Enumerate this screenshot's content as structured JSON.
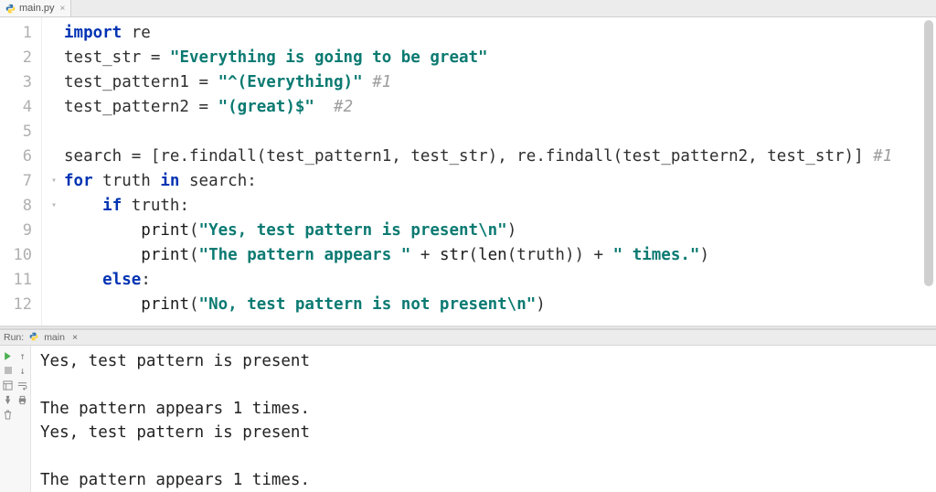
{
  "tabs": {
    "file": {
      "name": "main.py"
    }
  },
  "editor": {
    "line_numbers": [
      "1",
      "2",
      "3",
      "4",
      "5",
      "6",
      "7",
      "8",
      "9",
      "10",
      "11",
      "12"
    ],
    "lines": [
      {
        "tokens": [
          {
            "cls": "kw",
            "t": "import"
          },
          {
            "cls": "punct",
            "t": " "
          },
          {
            "cls": "ident",
            "t": "re"
          }
        ]
      },
      {
        "tokens": [
          {
            "cls": "ident",
            "t": "test_str "
          },
          {
            "cls": "punct",
            "t": "= "
          },
          {
            "cls": "str",
            "t": "\"Everything is going to be great\""
          }
        ]
      },
      {
        "tokens": [
          {
            "cls": "ident",
            "t": "test_pattern1 "
          },
          {
            "cls": "punct",
            "t": "= "
          },
          {
            "cls": "str",
            "t": "\"^(Everything)\""
          },
          {
            "cls": "punct",
            "t": " "
          },
          {
            "cls": "comment",
            "t": "#1"
          }
        ]
      },
      {
        "tokens": [
          {
            "cls": "ident",
            "t": "test_pattern2 "
          },
          {
            "cls": "punct",
            "t": "= "
          },
          {
            "cls": "str",
            "t": "\"(great)$\""
          },
          {
            "cls": "punct",
            "t": "  "
          },
          {
            "cls": "comment",
            "t": "#2"
          }
        ]
      },
      {
        "tokens": []
      },
      {
        "tokens": [
          {
            "cls": "ident",
            "t": "search "
          },
          {
            "cls": "punct",
            "t": "= ["
          },
          {
            "cls": "ident",
            "t": "re"
          },
          {
            "cls": "punct",
            "t": "."
          },
          {
            "cls": "ident",
            "t": "findall"
          },
          {
            "cls": "punct",
            "t": "("
          },
          {
            "cls": "ident",
            "t": "test_pattern1"
          },
          {
            "cls": "punct",
            "t": ", "
          },
          {
            "cls": "ident",
            "t": "test_str"
          },
          {
            "cls": "punct",
            "t": "), "
          },
          {
            "cls": "ident",
            "t": "re"
          },
          {
            "cls": "punct",
            "t": "."
          },
          {
            "cls": "ident",
            "t": "findall"
          },
          {
            "cls": "punct",
            "t": "("
          },
          {
            "cls": "ident",
            "t": "test_pattern2"
          },
          {
            "cls": "punct",
            "t": ", "
          },
          {
            "cls": "ident",
            "t": "test_str"
          },
          {
            "cls": "punct",
            "t": ")] "
          },
          {
            "cls": "comment",
            "t": "#1"
          }
        ]
      },
      {
        "fold": true,
        "tokens": [
          {
            "cls": "kw",
            "t": "for"
          },
          {
            "cls": "punct",
            "t": " "
          },
          {
            "cls": "ident",
            "t": "truth"
          },
          {
            "cls": "punct",
            "t": " "
          },
          {
            "cls": "kw",
            "t": "in"
          },
          {
            "cls": "punct",
            "t": " "
          },
          {
            "cls": "ident",
            "t": "search"
          },
          {
            "cls": "punct",
            "t": ":"
          }
        ]
      },
      {
        "indent": 1,
        "fold": true,
        "tokens": [
          {
            "cls": "kw",
            "t": "if"
          },
          {
            "cls": "punct",
            "t": " "
          },
          {
            "cls": "ident",
            "t": "truth"
          },
          {
            "cls": "punct",
            "t": ":"
          }
        ]
      },
      {
        "indent": 2,
        "tokens": [
          {
            "cls": "builtin",
            "t": "print"
          },
          {
            "cls": "punct",
            "t": "("
          },
          {
            "cls": "str",
            "t": "\"Yes, test pattern is present\\n\""
          },
          {
            "cls": "punct",
            "t": ")"
          }
        ]
      },
      {
        "indent": 2,
        "tokens": [
          {
            "cls": "builtin",
            "t": "print"
          },
          {
            "cls": "punct",
            "t": "("
          },
          {
            "cls": "str",
            "t": "\"The pattern appears \""
          },
          {
            "cls": "punct",
            "t": " + "
          },
          {
            "cls": "builtin",
            "t": "str"
          },
          {
            "cls": "punct",
            "t": "("
          },
          {
            "cls": "builtin",
            "t": "len"
          },
          {
            "cls": "punct",
            "t": "("
          },
          {
            "cls": "ident",
            "t": "truth"
          },
          {
            "cls": "punct",
            "t": ")) + "
          },
          {
            "cls": "str",
            "t": "\" times.\""
          },
          {
            "cls": "punct",
            "t": ")"
          }
        ]
      },
      {
        "indent": 1,
        "tokens": [
          {
            "cls": "kw",
            "t": "else"
          },
          {
            "cls": "punct",
            "t": ":"
          }
        ]
      },
      {
        "indent": 2,
        "tokens": [
          {
            "cls": "builtin",
            "t": "print"
          },
          {
            "cls": "punct",
            "t": "("
          },
          {
            "cls": "str",
            "t": "\"No, test pattern is not present\\n\""
          },
          {
            "cls": "punct",
            "t": ")"
          }
        ]
      }
    ]
  },
  "run": {
    "label": "Run:",
    "config": "main",
    "output": [
      "Yes, test pattern is present",
      "",
      "The pattern appears 1 times.",
      "Yes, test pattern is present",
      "",
      "The pattern appears 1 times."
    ]
  }
}
